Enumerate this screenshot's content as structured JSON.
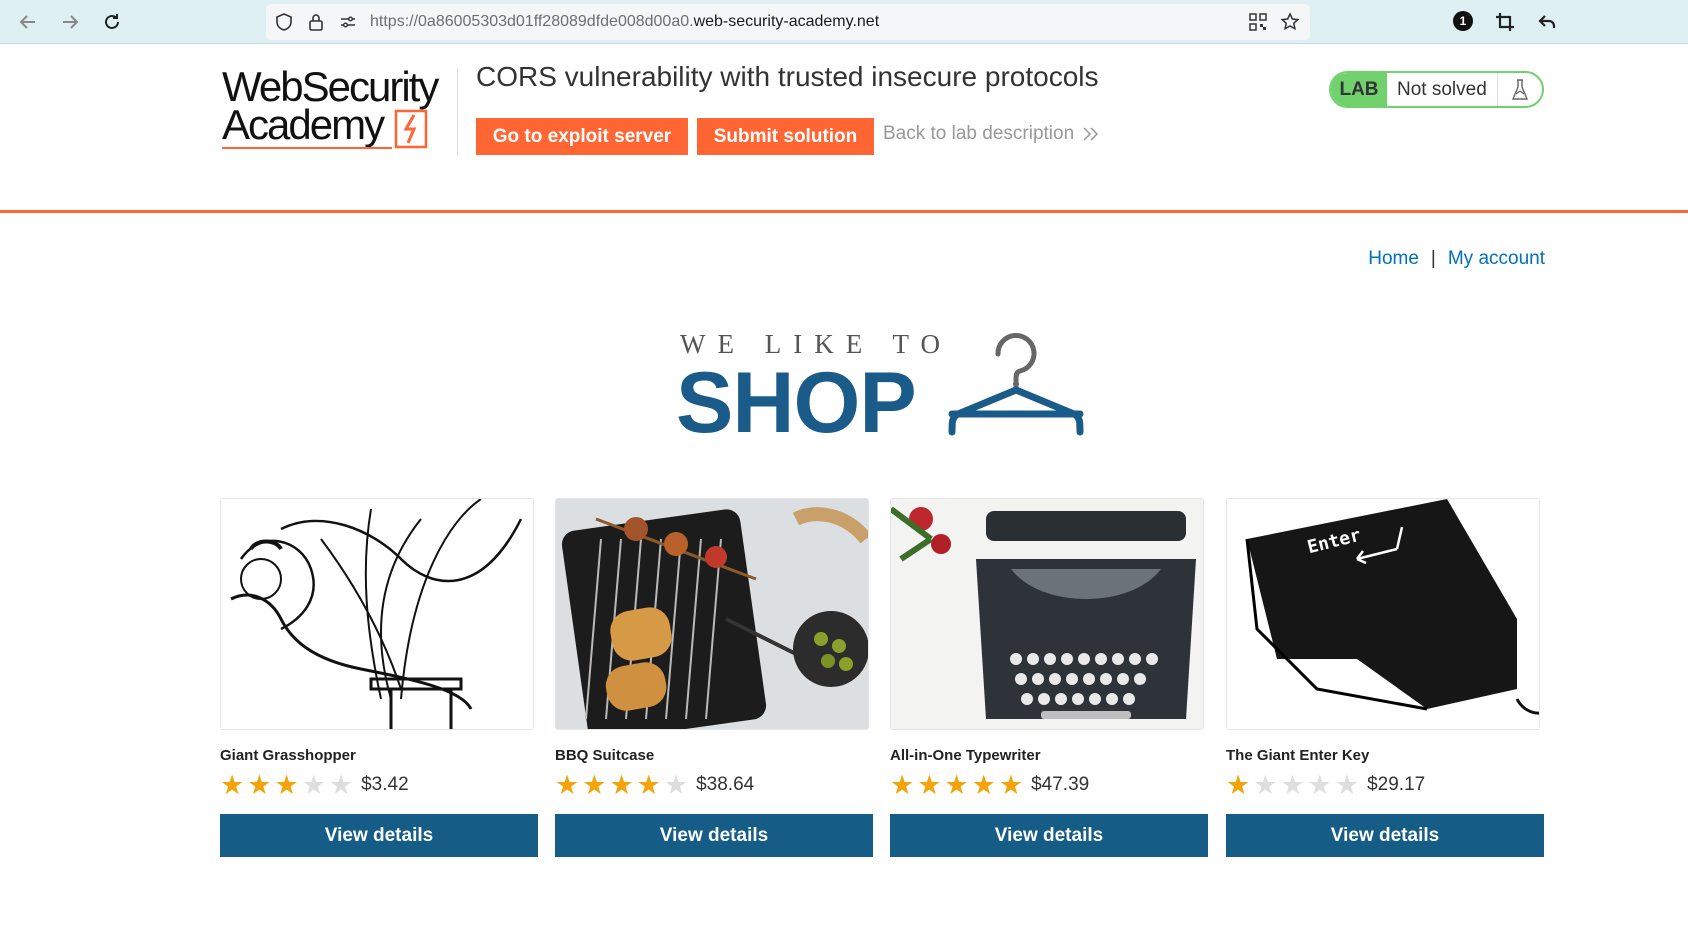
{
  "browser": {
    "url_prefix": "https://0a86005303d01ff28089dfde008d00a0.",
    "url_host": "web-security-academy.net",
    "notification_count": "1"
  },
  "header": {
    "logo_line1": "WebSecurity",
    "logo_line2": "Academy",
    "lab_title": "CORS vulnerability with trusted insecure protocols",
    "exploit_button": "Go to exploit server",
    "submit_button": "Submit solution",
    "back_link": "Back to lab description",
    "lab_badge": "LAB",
    "lab_state": "Not solved"
  },
  "nav": {
    "home": "Home",
    "separator": "|",
    "account": "My account"
  },
  "banner": {
    "tagline": "WE LIKE TO",
    "word": "SHOP"
  },
  "products": [
    {
      "name": "Giant Grasshopper",
      "rating": 3,
      "price": "$3.42",
      "button": "View details",
      "image_icon": "grasshopper-image"
    },
    {
      "name": "BBQ Suitcase",
      "rating": 4,
      "price": "$38.64",
      "button": "View details",
      "image_icon": "bbq-image"
    },
    {
      "name": "All-in-One Typewriter",
      "rating": 5,
      "price": "$47.39",
      "button": "View details",
      "image_icon": "typewriter-image"
    },
    {
      "name": "The Giant Enter Key",
      "rating": 1,
      "price": "$29.17",
      "button": "View details",
      "image_icon": "enter-key-image",
      "image_text": "Enter"
    }
  ],
  "colors": {
    "accent_orange": "#ff6633",
    "shop_blue": "#1a5b8a",
    "button_blue": "#155d86",
    "star_gold": "#f5a30a",
    "lab_green": "#70d16d"
  }
}
